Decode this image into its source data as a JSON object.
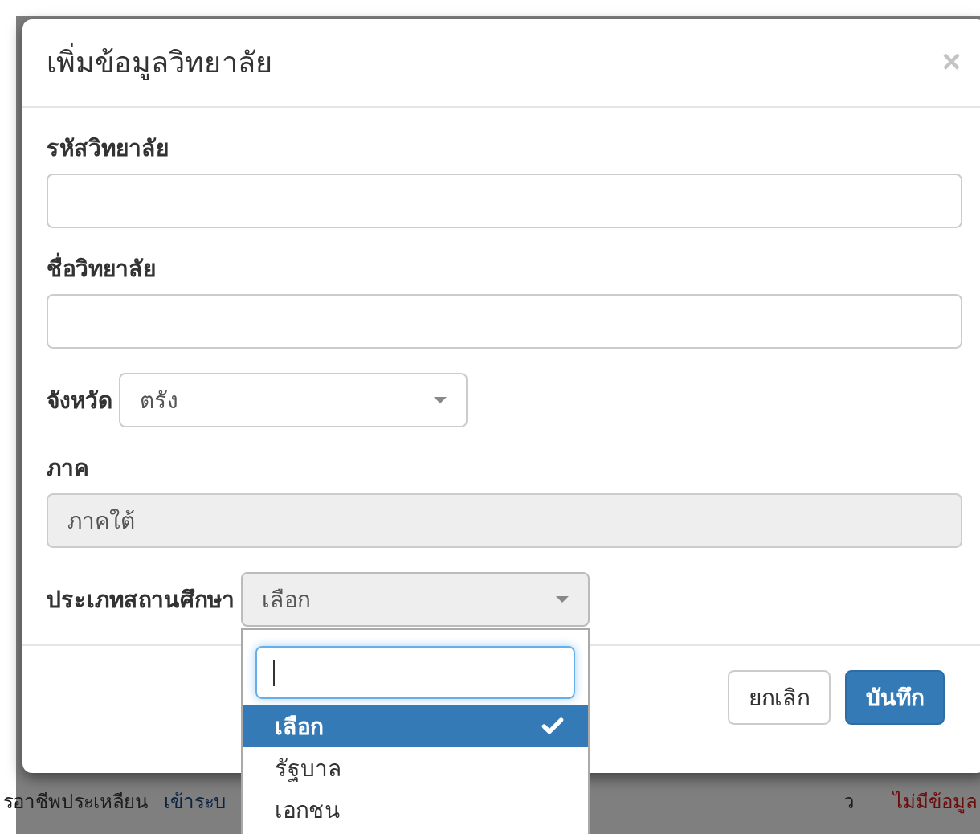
{
  "modal": {
    "title": "เพิ่มข้อมูลวิทยาลัย",
    "close": "×",
    "fields": [
      {
        "kind": "text",
        "label": "รหัสวิทยาลัย"
      },
      {
        "kind": "text",
        "label": "ชื่อวิทยาลัย"
      },
      {
        "kind": "select",
        "label": "จังหวัด",
        "value": "ตรัง",
        "open": false
      },
      {
        "kind": "readonly",
        "label": "ภาค",
        "value": "ภาคใต้"
      },
      {
        "kind": "select",
        "label": "ประเภทสถานศึกษา",
        "value": "เลือก",
        "open": true,
        "options": [
          {
            "label": "เลือก",
            "selected": true
          },
          {
            "label": "รัฐบาล",
            "selected": false
          },
          {
            "label": "เอกชน",
            "selected": false
          }
        ]
      }
    ],
    "buttons": [
      {
        "kind": "default",
        "label": "ยกเลิก"
      },
      {
        "kind": "primary",
        "label": "บันทึก"
      }
    ]
  },
  "background": {
    "texts": [
      {
        "kind": "plain",
        "text": "รอาชีพประเหลียน"
      },
      {
        "kind": "link",
        "text": "เข้าระบ"
      },
      {
        "kind": "plain",
        "text": "ว"
      },
      {
        "kind": "error",
        "text": "ไม่มีข้อมูล"
      }
    ]
  }
}
